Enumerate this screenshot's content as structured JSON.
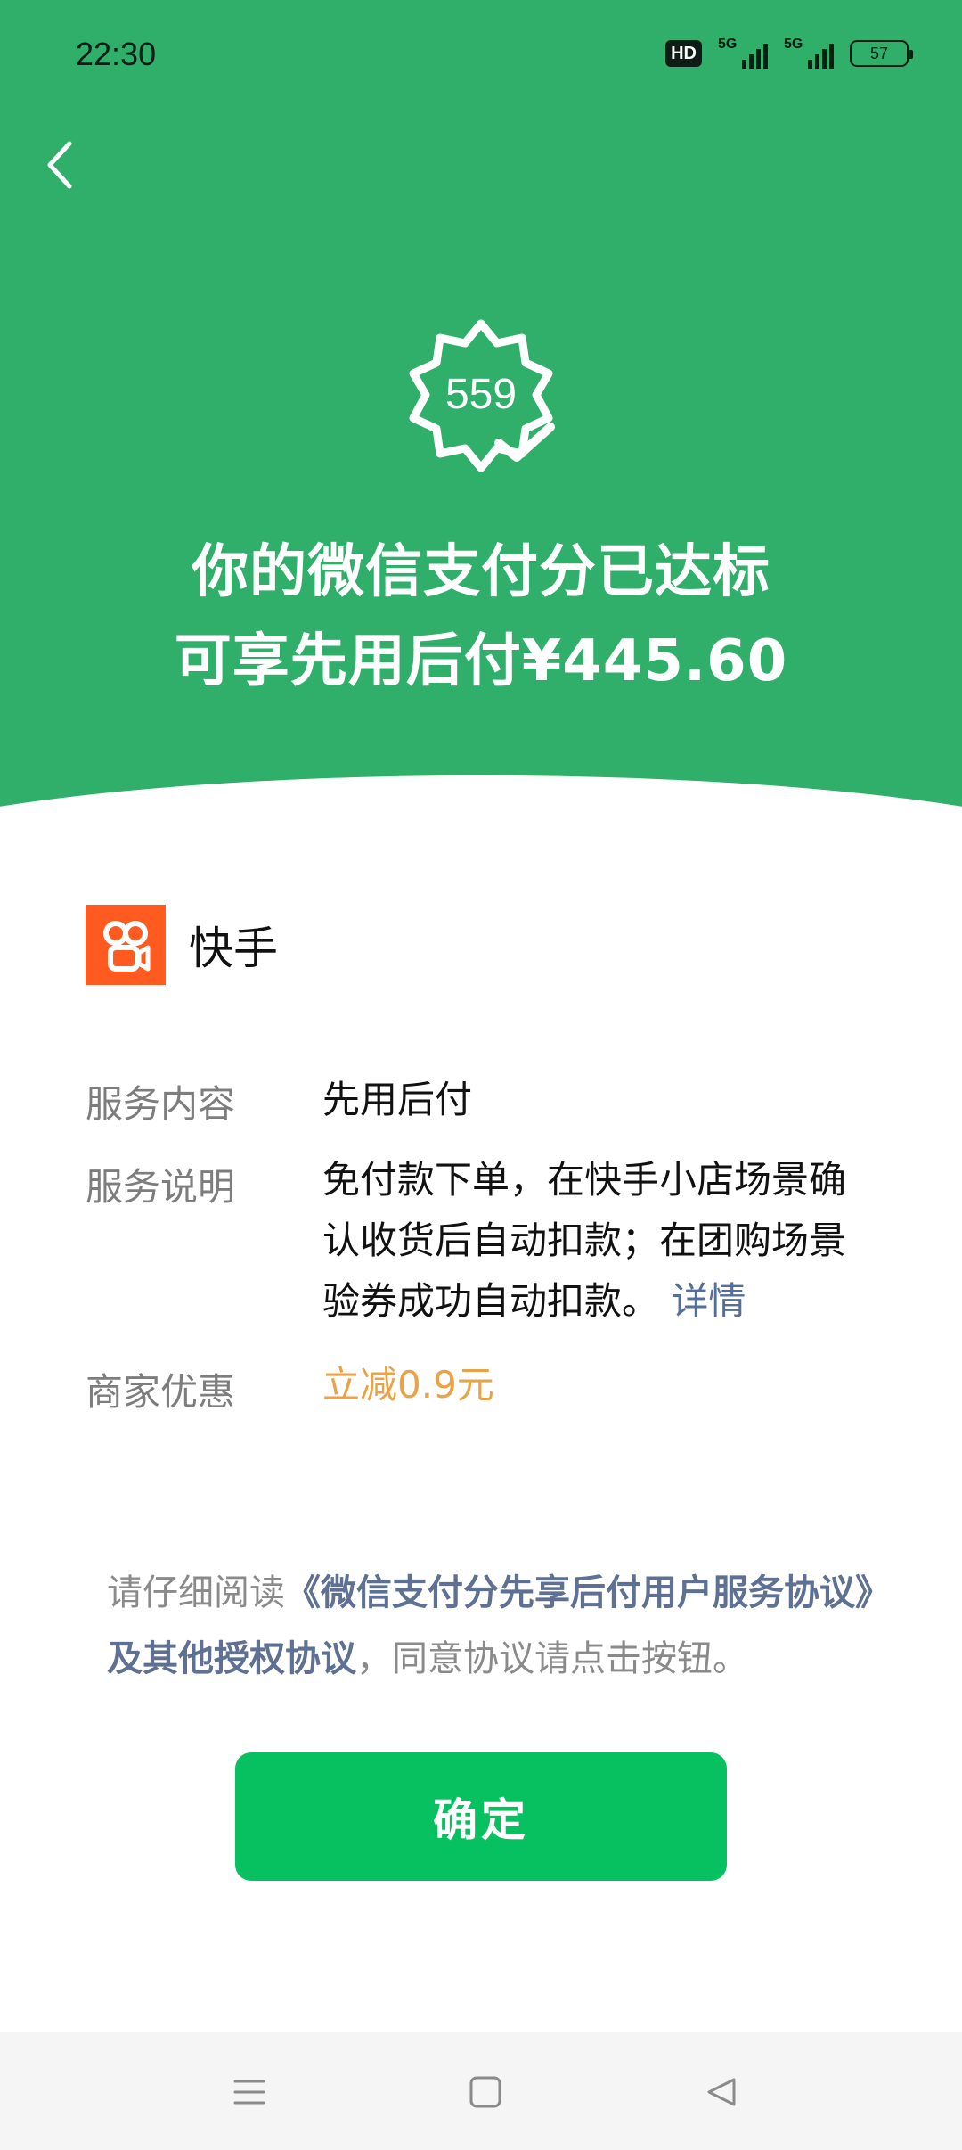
{
  "status_bar": {
    "time": "22:30",
    "hd_badge": "HD",
    "signal1_label": "5G",
    "signal2_label": "5G",
    "battery": "57"
  },
  "header": {
    "back_icon": "chevron-left-icon",
    "score": "559",
    "line1": "你的微信支付分已达标",
    "line2": "可享先用后付¥445.60"
  },
  "merchant": {
    "name": "快手",
    "logo_icon": "kuaishou-logo"
  },
  "info": {
    "rows": [
      {
        "label": "服务内容",
        "value": "先用后付"
      },
      {
        "label": "服务说明",
        "value": "免付款下单，在快手小店场景确认收货后自动扣款；在团购场景验券成功自动扣款。",
        "link": "详情"
      },
      {
        "label": "商家优惠",
        "value": "立减0.9元"
      }
    ]
  },
  "agreement": {
    "prefix": "请仔细阅读",
    "link": "《微信支付分先享后付用户服务协议》及其他授权协议",
    "suffix": "，同意协议请点击按钮。"
  },
  "confirm_label": "确定",
  "colors": {
    "header_green": "#2faf6a",
    "button_green": "#07c160",
    "discount_orange": "#e9a245",
    "link_blue": "#546e9b",
    "logo_orange": "#ff5a1f"
  },
  "nav": {
    "menu_icon": "menu-icon",
    "home_icon": "home-square-icon",
    "back_icon": "back-triangle-icon"
  }
}
